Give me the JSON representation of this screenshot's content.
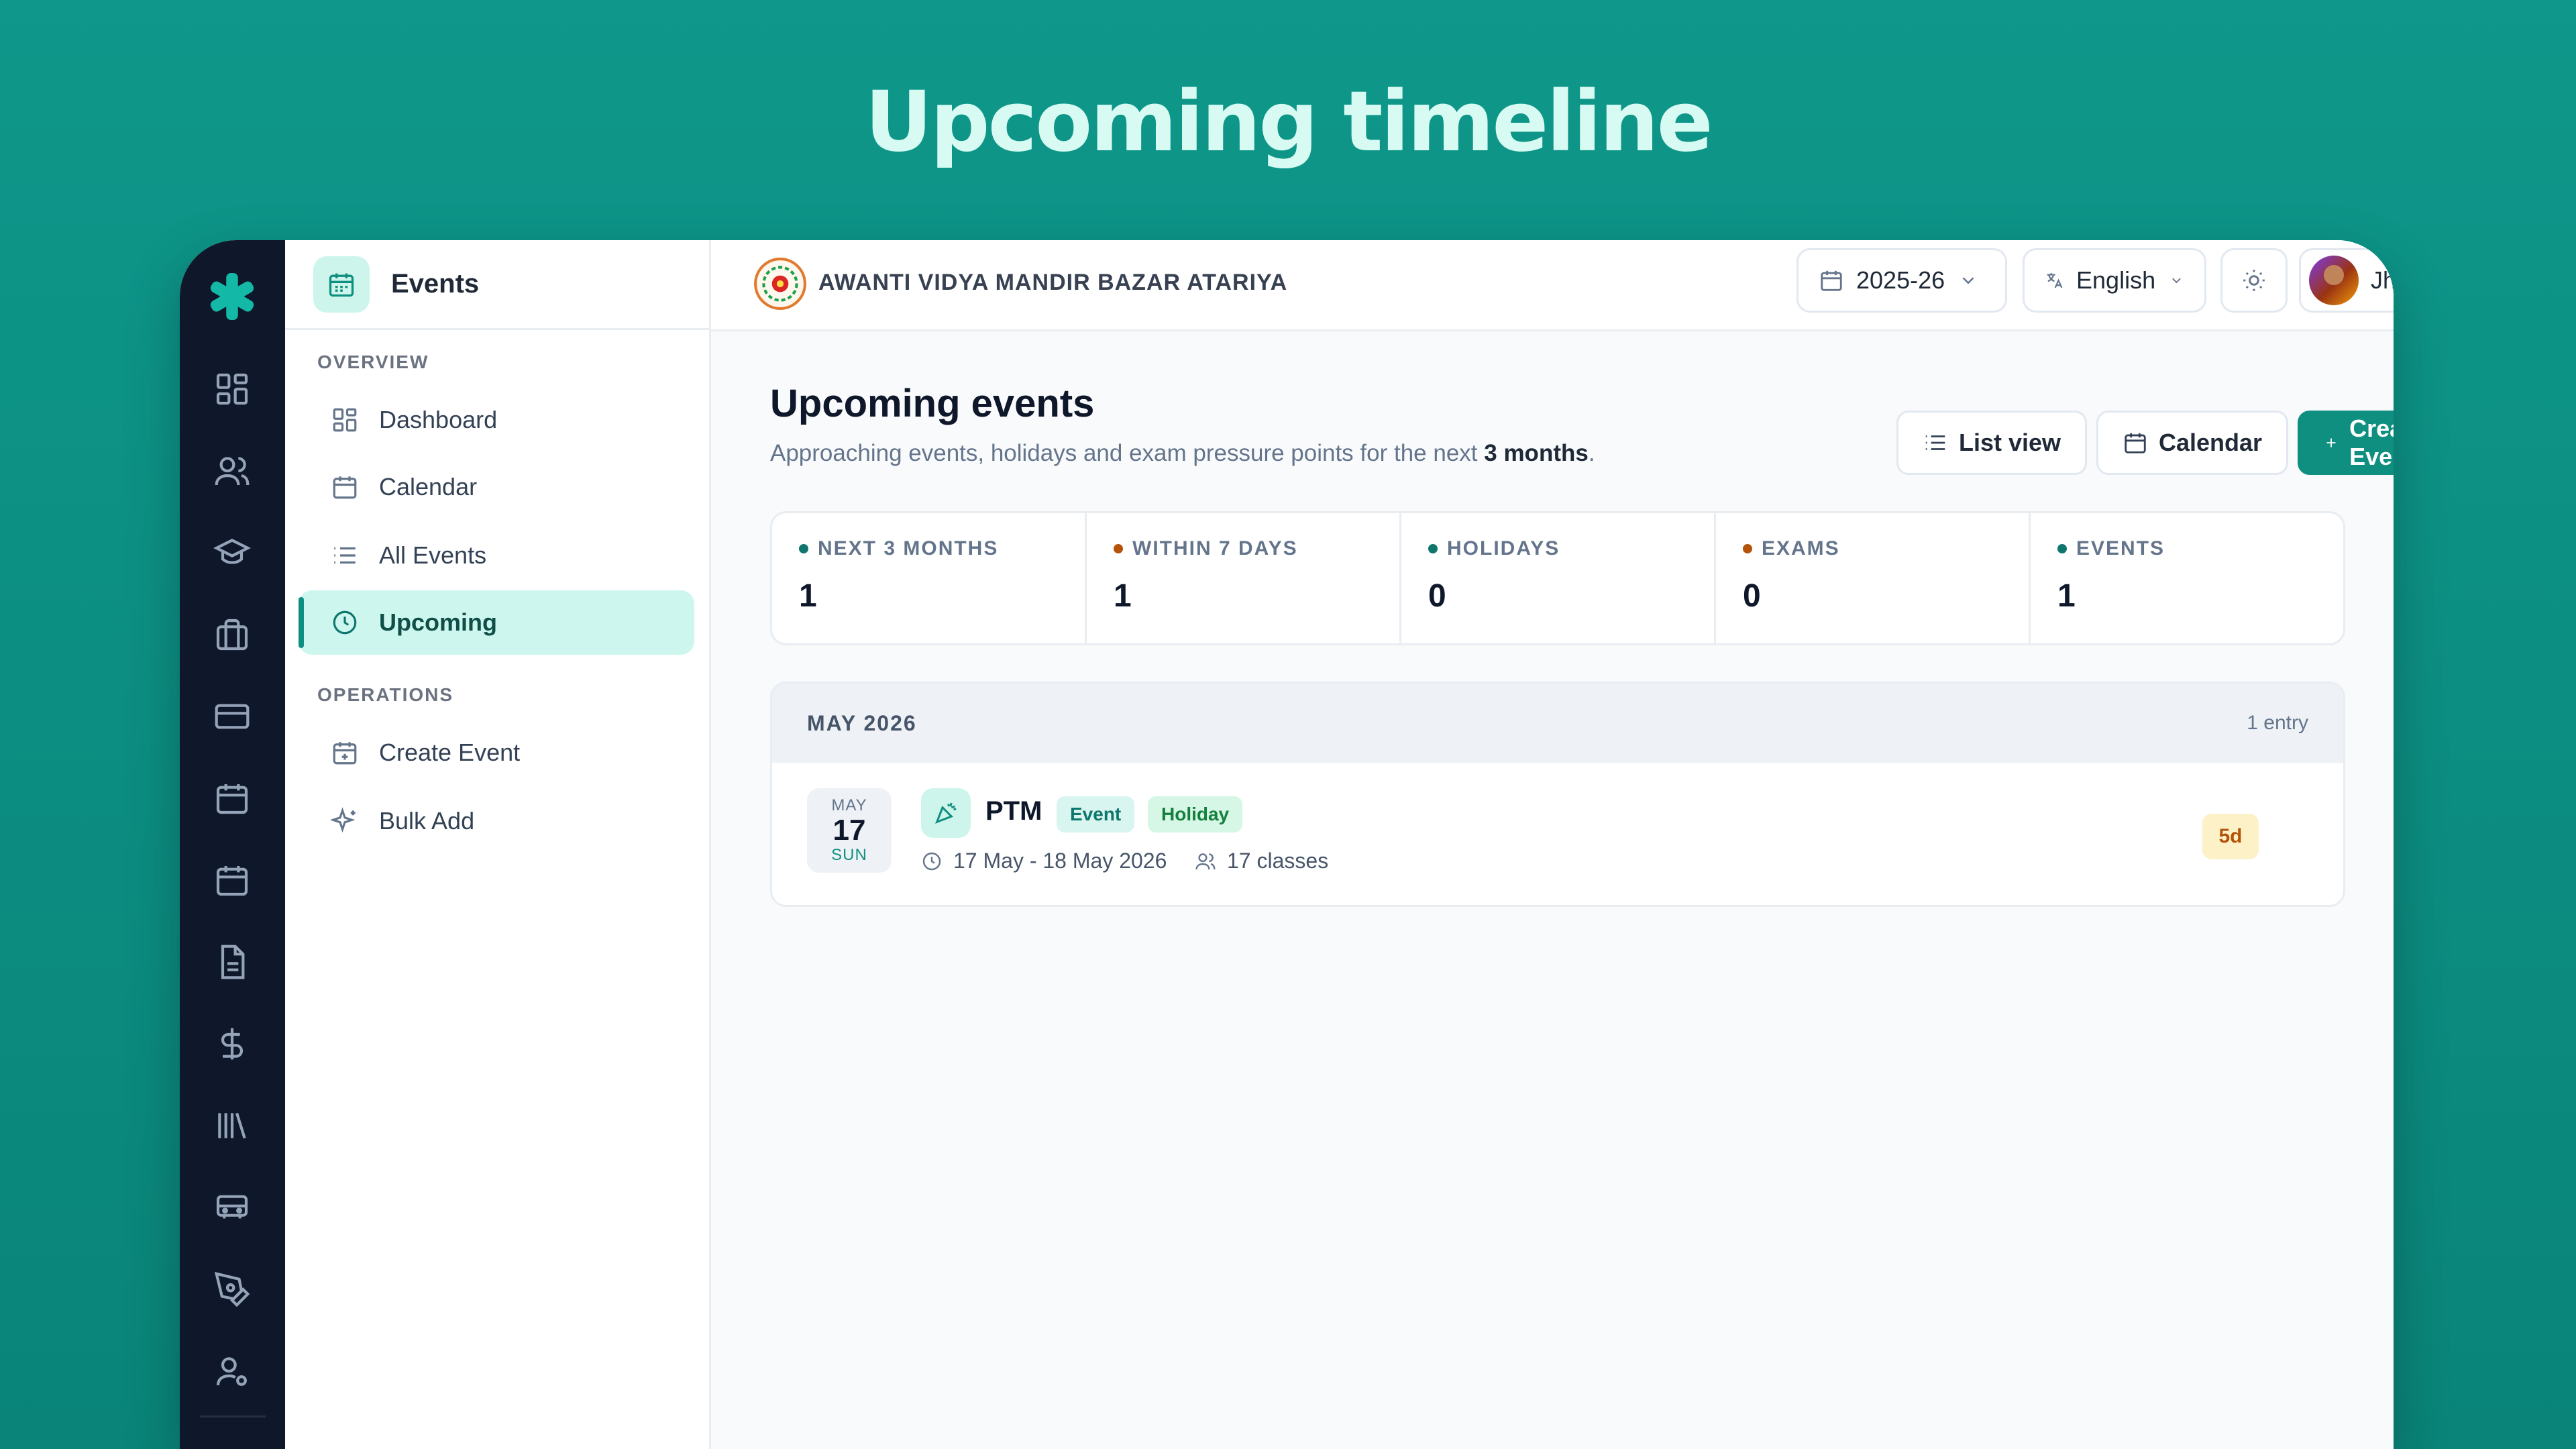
{
  "promo": {
    "title": "Upcoming timeline"
  },
  "sidebar": {
    "title": "Events",
    "sections": [
      {
        "label": "OVERVIEW",
        "items": [
          {
            "label": "Dashboard",
            "icon": "dashboard-icon"
          },
          {
            "label": "Calendar",
            "icon": "calendar-icon"
          },
          {
            "label": "All Events",
            "icon": "list-icon"
          },
          {
            "label": "Upcoming",
            "icon": "clock-icon",
            "active": true
          }
        ]
      },
      {
        "label": "OPERATIONS",
        "items": [
          {
            "label": "Create Event",
            "icon": "calendar-plus-icon"
          },
          {
            "label": "Bulk Add",
            "icon": "sparkles-icon"
          }
        ]
      }
    ]
  },
  "rail": {
    "icons": [
      "dashboard-icon",
      "users-icon",
      "graduation-cap-icon",
      "briefcase-icon",
      "credit-card-icon",
      "calendar-icon",
      "calendar-check-icon",
      "document-icon",
      "dollar-icon",
      "library-icon",
      "bus-icon",
      "pen-tool-icon",
      "user-cog-icon"
    ]
  },
  "topbar": {
    "school_name": "AWANTI VIDYA MANDIR BAZAR ATARIYA",
    "session": "2025-26",
    "language": "English",
    "user": "Jharendra"
  },
  "page": {
    "title": "Upcoming events",
    "subtitle_pre": "Approaching events, holidays and exam pressure points for the next ",
    "subtitle_bold": "3 months",
    "subtitle_post": ".",
    "list_view": "List view",
    "calendar": "Calendar",
    "create": "Create Event"
  },
  "stats": [
    {
      "label": "NEXT 3 MONTHS",
      "value": "1",
      "color": "#0f766e"
    },
    {
      "label": "WITHIN 7 DAYS",
      "value": "1",
      "color": "#b45309"
    },
    {
      "label": "HOLIDAYS",
      "value": "0",
      "color": "#0f766e"
    },
    {
      "label": "EXAMS",
      "value": "0",
      "color": "#b45309"
    },
    {
      "label": "EVENTS",
      "value": "1",
      "color": "#0f766e"
    }
  ],
  "months": [
    {
      "title": "MAY 2026",
      "count": "1 entry",
      "events": [
        {
          "mon": "MAY",
          "day": "17",
          "dow": "SUN",
          "name": "PTM",
          "tags": [
            "Event",
            "Holiday"
          ],
          "range": "17 May - 18 May 2026",
          "classes": "17 classes",
          "badge": "5d"
        }
      ]
    }
  ],
  "colors": {
    "accent": "#0f8f7f",
    "rail": "#0f172a",
    "background": "#0e978a"
  }
}
